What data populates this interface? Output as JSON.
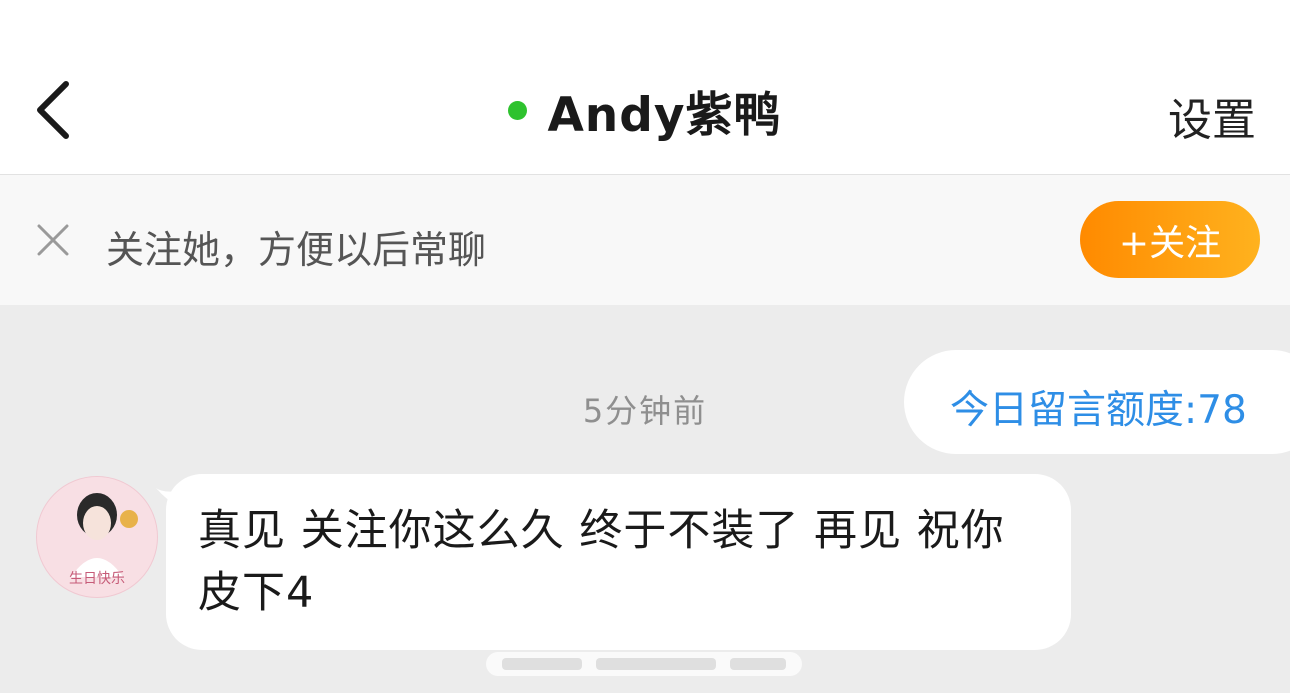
{
  "header": {
    "back_icon": "chevron-left-icon",
    "title": "Andy紫鸭",
    "online_status_color": "#2ec22e",
    "settings_label": "设置"
  },
  "follow_bar": {
    "close_icon": "close-icon",
    "prompt_text": "关注她，方便以后常聊",
    "follow_button_label": "+关注",
    "follow_button_color": "#ff8a00"
  },
  "chat": {
    "timestamp": "5分钟前",
    "quota_text": "今日留言额度:78",
    "quota_color": "#2e8ee6",
    "messages": [
      {
        "sender_avatar": "avatar-icon",
        "avatar_caption": "生日快乐",
        "text": "真见 关注你这么久 终于不装了 再见 祝你皮下4"
      }
    ]
  },
  "watermark_icon": "weibo-watermark-icon"
}
